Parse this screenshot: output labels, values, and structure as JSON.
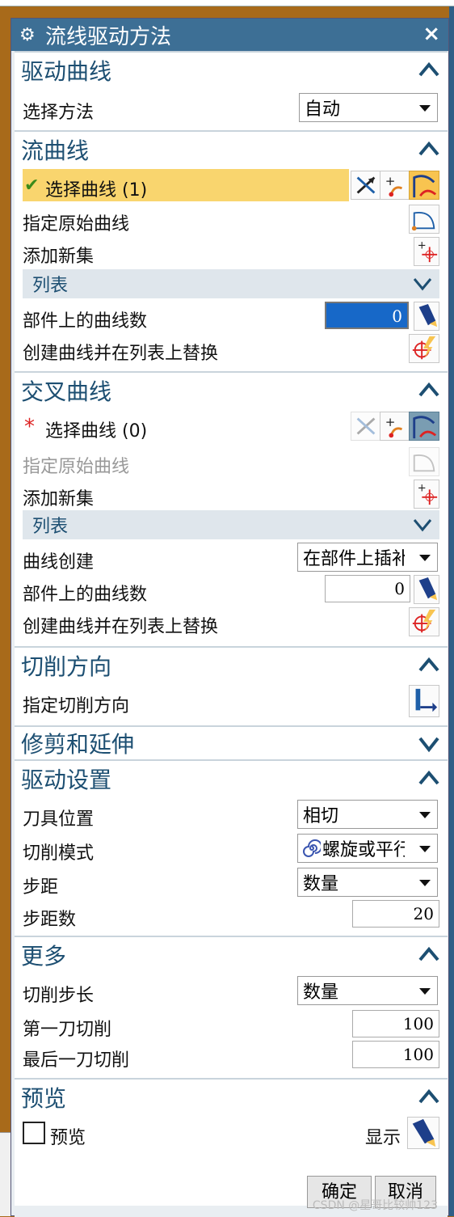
{
  "dialog": {
    "title": "流线驱动方法",
    "close": "×"
  },
  "sections": {
    "drive_curve": {
      "title": "驱动曲线",
      "select_method_label": "选择方法",
      "select_method_value": "自动"
    },
    "flow_curve": {
      "title": "流曲线",
      "select_curve": "选择曲线 (1)",
      "check": "✔",
      "specify_orig": "指定原始曲线",
      "add_set": "添加新集",
      "list": "列表",
      "curves_on_part": "部件上的曲线数",
      "curves_on_part_value": "0",
      "create_replace": "创建曲线并在列表上替换"
    },
    "cross_curve": {
      "title": "交叉曲线",
      "select_curve": "选择曲线 (0)",
      "required": "*",
      "specify_orig": "指定原始曲线",
      "add_set": "添加新集",
      "list": "列表",
      "curve_create_label": "曲线创建",
      "curve_create_value": "在部件上插补",
      "curves_on_part": "部件上的曲线数",
      "curves_on_part_value": "0",
      "create_replace": "创建曲线并在列表上替换"
    },
    "cut_direction": {
      "title": "切削方向",
      "specify": "指定切削方向"
    },
    "trim_extend": {
      "title": "修剪和延伸"
    },
    "drive_settings": {
      "title": "驱动设置",
      "tool_pos_label": "刀具位置",
      "tool_pos_value": "相切",
      "cut_mode_label": "切削模式",
      "cut_mode_value": "螺旋或平行",
      "stepover_label": "步距",
      "stepover_value": "数量",
      "step_count_label": "步距数",
      "step_count_value": "20"
    },
    "more": {
      "title": "更多",
      "cut_step_label": "切削步长",
      "cut_step_value": "数量",
      "first_cut_label": "第一刀切削",
      "first_cut_value": "100",
      "last_cut_label": "最后一刀切削",
      "last_cut_value": "100"
    },
    "preview": {
      "title": "预览",
      "preview_label": "预览",
      "show_label": "显示"
    }
  },
  "buttons": {
    "ok": "确定",
    "cancel": "取消"
  },
  "watermark": "CSDN @星哥比较帅123"
}
